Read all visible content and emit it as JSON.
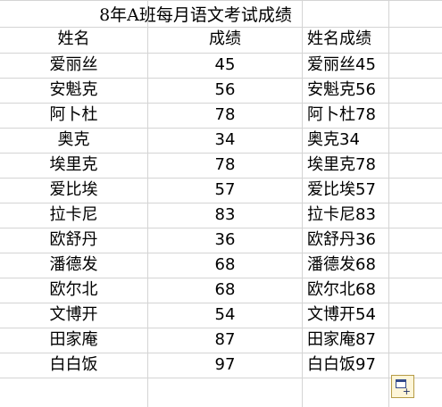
{
  "sheet": {
    "title": "8年A班每月语文考试成绩",
    "headers": {
      "name": "姓名",
      "score": "成绩",
      "combined": "姓名成绩"
    },
    "rows": [
      {
        "name": "爱丽丝",
        "score": "45",
        "combined": "爱丽丝45"
      },
      {
        "name": "安魁克",
        "score": "56",
        "combined": "安魁克56"
      },
      {
        "name": "阿卜杜",
        "score": "78",
        "combined": "阿卜杜78"
      },
      {
        "name": "奥克",
        "score": "34",
        "combined": "奥克34"
      },
      {
        "name": "埃里克",
        "score": "78",
        "combined": "埃里克78"
      },
      {
        "name": "爱比埃",
        "score": "57",
        "combined": "爱比埃57"
      },
      {
        "name": "拉卡尼",
        "score": "83",
        "combined": "拉卡尼83"
      },
      {
        "name": "欧舒丹",
        "score": "36",
        "combined": "欧舒丹36"
      },
      {
        "name": "潘德发",
        "score": "68",
        "combined": "潘德发68"
      },
      {
        "name": "欧尔北",
        "score": "68",
        "combined": "欧尔北68"
      },
      {
        "name": "文博开",
        "score": "54",
        "combined": "文博开54"
      },
      {
        "name": "田家庵",
        "score": "87",
        "combined": "田家庵87"
      },
      {
        "name": "白白饭",
        "score": "97",
        "combined": "白白饭97"
      }
    ]
  },
  "paste_options": {
    "icon": "paste-options-icon",
    "plus": "+"
  }
}
